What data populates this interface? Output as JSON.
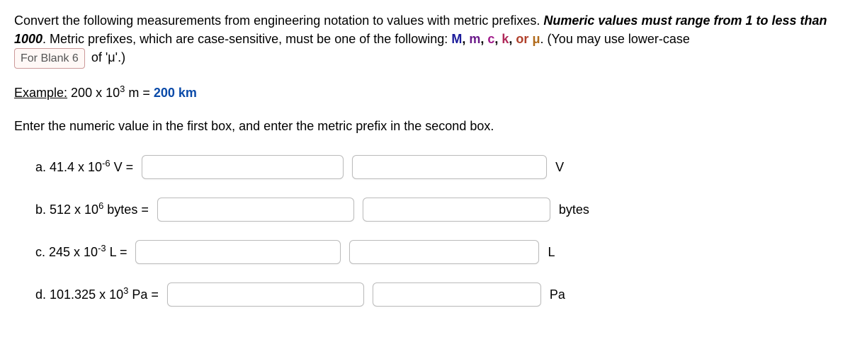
{
  "intro": {
    "line1_a": "Convert the following measurements from engineering notation to values with metric prefixes. ",
    "line1_b": "Numeric values must range from 1 to less than 1000",
    "line1_c": ".  Metric prefixes, which are case-sensitive, must be one of the following: ",
    "pfx_M": "M",
    "sep1": ", ",
    "pfx_m": "m",
    "sep2": ", ",
    "pfx_c": "c",
    "sep3": ", ",
    "pfx_k": "k",
    "sep4": ", ",
    "word_or": "or",
    "space": " ",
    "pfx_mu": "μ",
    "line1_d": ". (You may use lower-case",
    "blank_label": "For Blank 6",
    "line2_tail": "of 'μ'.)"
  },
  "example": {
    "label": "Example:",
    "lhs_a": " 200 x 10",
    "lhs_exp": "3",
    "lhs_b": " m = ",
    "rhs": "200 km"
  },
  "explain": "Enter the numeric value in the first box, and enter the metric prefix in the second box.",
  "items": {
    "a": {
      "pre": "a.  41.4 x 10",
      "exp": "-6",
      "post": " V =",
      "unit": "V"
    },
    "b": {
      "pre": "b.  512 x 10",
      "exp": "6",
      "post": " bytes =",
      "unit": "bytes"
    },
    "c": {
      "pre": "c.  245 x 10",
      "exp": "-3",
      "post": " L =",
      "unit": "L"
    },
    "d": {
      "pre": "d.  101.325 x 10",
      "exp": "3",
      "post": " Pa =",
      "unit": "Pa"
    }
  }
}
